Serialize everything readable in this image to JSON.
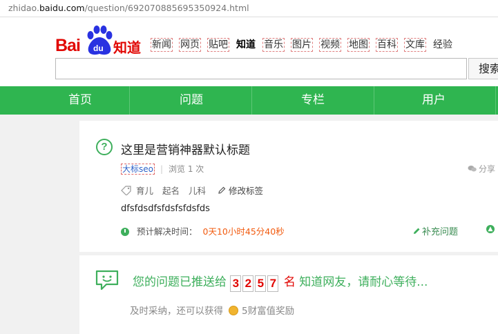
{
  "browser": {
    "url_prefix": "zhidao.",
    "url_domain": "baidu.com",
    "url_path": "/question/692070885695350924.html"
  },
  "logo": {
    "bai": "Bai",
    "du": "du",
    "brand": "知道"
  },
  "top_nav": [
    "新闻",
    "网页",
    "贴吧",
    "知道",
    "音乐",
    "图片",
    "视频",
    "地图",
    "百科",
    "文库",
    "经验"
  ],
  "active_nav": "知道",
  "search": {
    "button_label": "搜索"
  },
  "main_nav": [
    "首页",
    "问题",
    "专栏",
    "用户"
  ],
  "question": {
    "title": "这里是营销神器默认标题",
    "user": "大标seo",
    "views": "浏览 1 次",
    "share": "分享",
    "tags": [
      "育儿",
      "起名",
      "儿科"
    ],
    "edit_tags": "修改标签",
    "content": "dfsfdsdfsfdsfsfdsfds",
    "expect_label": "预计解决时间：",
    "expect_time": "0天10小时45分40秒",
    "supplement": "补充问题"
  },
  "push": {
    "prefix": "您的问题已推送给",
    "digits": [
      "3",
      "2",
      "5",
      "7"
    ],
    "unit": "名",
    "suffix": "知道网友，请耐心等待...",
    "reward_text": "及时采纳，还可以获得",
    "reward_amount": "5财富值奖励"
  },
  "colors": {
    "green": "#2fb550",
    "red": "#e10602",
    "orange": "#f25b0f",
    "blue": "#2e62c8"
  }
}
